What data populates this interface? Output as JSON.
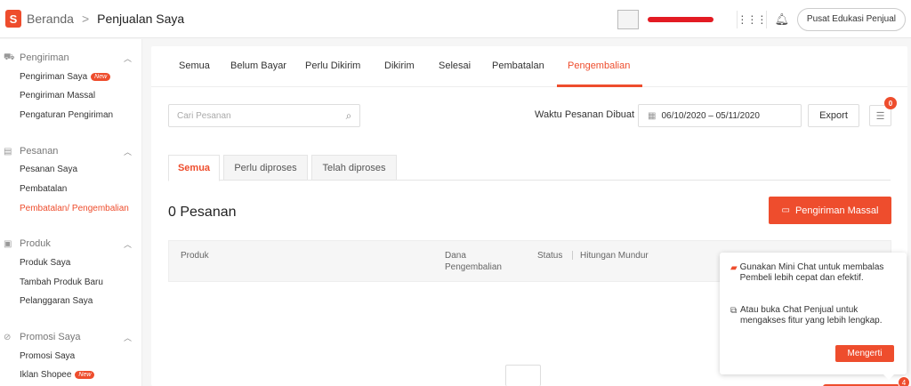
{
  "header": {
    "logo_letter": "S",
    "breadcrumb_home": "Beranda",
    "breadcrumb_separator": ">",
    "breadcrumb_current": "Penjualan Saya",
    "help_button": "Pusat Edukasi Penjual",
    "icons": [
      "apps-grid-icon",
      "bell-icon"
    ]
  },
  "sidebar": {
    "groups": [
      {
        "title": "Pengiriman",
        "icon": "truck-icon",
        "items": [
          {
            "label": "Pengiriman Saya",
            "badge": "New"
          },
          {
            "label": "Pengiriman Massal"
          },
          {
            "label": "Pengaturan Pengiriman"
          }
        ]
      },
      {
        "title": "Pesanan",
        "icon": "clipboard-icon",
        "items": [
          {
            "label": "Pesanan Saya"
          },
          {
            "label": "Pembatalan"
          },
          {
            "label": "Pembatalan/ Pengembalian",
            "active": true
          }
        ]
      },
      {
        "title": "Produk",
        "icon": "box-icon",
        "items": [
          {
            "label": "Produk Saya"
          },
          {
            "label": "Tambah Produk Baru"
          },
          {
            "label": "Pelanggaran Saya"
          }
        ]
      },
      {
        "title": "Promosi Saya",
        "icon": "tag-icon",
        "items": [
          {
            "label": "Promosi Saya"
          },
          {
            "label": "Iklan Shopee",
            "badge": "New"
          }
        ]
      }
    ]
  },
  "tabs": [
    {
      "label": "Semua"
    },
    {
      "label": "Belum Bayar"
    },
    {
      "label": "Perlu Dikirim"
    },
    {
      "label": "Dikirim"
    },
    {
      "label": "Selesai"
    },
    {
      "label": "Pembatalan"
    },
    {
      "label": "Pengembalian",
      "active": true
    }
  ],
  "filters": {
    "search_placeholder": "Cari Pesanan",
    "date_label": "Waktu Pesanan Dibuat",
    "date_range": "06/10/2020 – 05/11/2020",
    "export_label": "Export",
    "list_badge_count": "0"
  },
  "subtabs": [
    {
      "label": "Semua",
      "active": true
    },
    {
      "label": "Perlu diproses"
    },
    {
      "label": "Telah diproses"
    }
  ],
  "orders": {
    "count_label": "0 Pesanan",
    "mass_ship_label": "Pengiriman Massal"
  },
  "table": {
    "columns": [
      "Produk",
      "Dana Pengembalian",
      "Status",
      "Hitungan Mundur"
    ]
  },
  "popover": {
    "tip1": "Gunakan Mini Chat untuk membalas Pembeli lebih cepat dan efektif.",
    "tip2": "Atau buka Chat Penjual untuk mengakses fitur yang lebih lengkap.",
    "button": "Mengerti"
  },
  "chat": {
    "badge_count": "4"
  },
  "colors": {
    "accent": "#ee4d2d"
  }
}
